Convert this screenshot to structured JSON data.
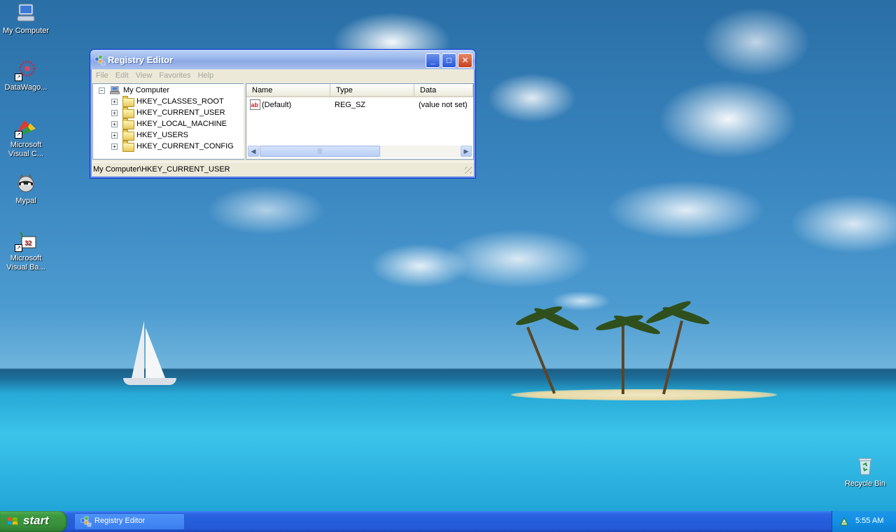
{
  "desktop": {
    "icons": [
      {
        "label": "My Computer",
        "icon": "my-computer-icon"
      },
      {
        "label": "DataWago...",
        "icon": "datawagon-icon"
      },
      {
        "label": "Microsoft Visual C...",
        "line1": "Microsoft",
        "line2": "Visual C...",
        "icon": "visual-cpp-icon"
      },
      {
        "label": "Mypal",
        "icon": "mypal-raccoon-icon"
      },
      {
        "label": "Microsoft Visual Ba...",
        "line1": "Microsoft",
        "line2": "Visual Ba...",
        "icon": "visual-basic-icon"
      },
      {
        "label": "Recycle Bin",
        "icon": "recycle-bin-icon"
      }
    ]
  },
  "window": {
    "title": "Registry Editor",
    "controls": {
      "minimize": "_",
      "maximize": "□",
      "close": "✕"
    },
    "menu": [
      "File",
      "Edit",
      "View",
      "Favorites",
      "Help"
    ],
    "tree": {
      "root": "My Computer",
      "children": [
        "HKEY_CLASSES_ROOT",
        "HKEY_CURRENT_USER",
        "HKEY_LOCAL_MACHINE",
        "HKEY_USERS",
        "HKEY_CURRENT_CONFIG"
      ]
    },
    "list": {
      "columns": [
        "Name",
        "Type",
        "Data"
      ],
      "rows": [
        {
          "name": "(Default)",
          "type": "REG_SZ",
          "data": "(value not set)"
        }
      ]
    },
    "status": "My Computer\\HKEY_CURRENT_USER"
  },
  "taskbar": {
    "start_label": "start",
    "tasks": [
      "Registry Editor"
    ],
    "clock": "5:55 AM"
  },
  "colors": {
    "title_active": "#0a5ef0",
    "start_green": "#3c9a40",
    "taskbar_blue": "#245edb"
  }
}
